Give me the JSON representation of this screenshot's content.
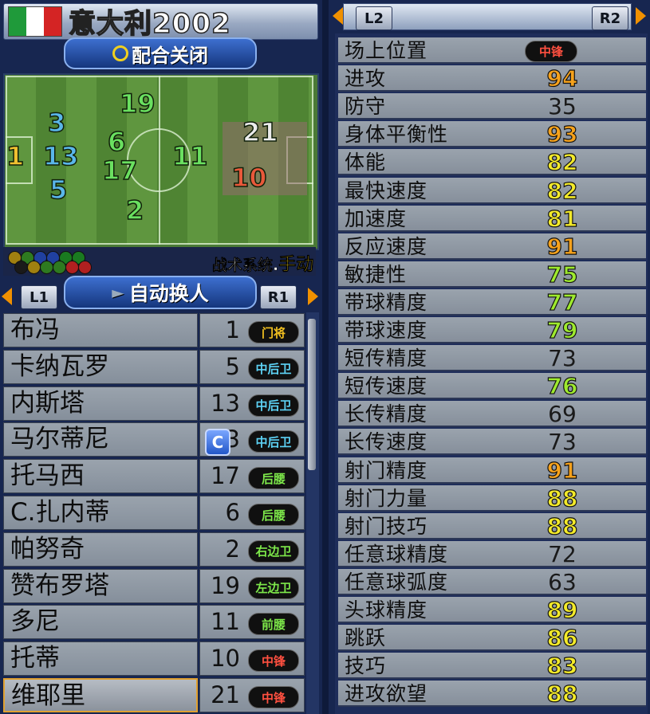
{
  "team": {
    "name": "意大利2002",
    "flag_colors": [
      "#1f9a3a",
      "#ffffff",
      "#d42424"
    ]
  },
  "tactic_button": {
    "label": "配合关闭",
    "key_icon": "circle-button-icon"
  },
  "pitch": {
    "players": [
      {
        "number": "1",
        "role": "gk"
      },
      {
        "number": "3",
        "role": "df"
      },
      {
        "number": "13",
        "role": "df"
      },
      {
        "number": "5",
        "role": "df"
      },
      {
        "number": "19",
        "role": "mf"
      },
      {
        "number": "6",
        "role": "mf"
      },
      {
        "number": "17",
        "role": "mf"
      },
      {
        "number": "2",
        "role": "mf"
      },
      {
        "number": "11",
        "role": "mf"
      },
      {
        "number": "21",
        "role": "fw-white"
      },
      {
        "number": "10",
        "role": "fw-red"
      }
    ],
    "system_label": "战术系统.",
    "system_mode": "手动",
    "dot_colors": [
      "#a08010",
      "#2e7a20",
      "#2040a0",
      "#2040a0",
      "#1a7a20",
      "#1a7a20",
      "#1a1a1a",
      "#a08010",
      "#2e7a20",
      "#2e7a20",
      "#b02020",
      "#b02020"
    ]
  },
  "nav": {
    "l1": "L1",
    "r1": "R1",
    "l2": "L2",
    "r2": "R2",
    "auto_sub_label": "自动换人"
  },
  "roster": [
    {
      "name": "布冯",
      "number": "1",
      "position": "门将",
      "pos_class": "gk"
    },
    {
      "name": "卡纳瓦罗",
      "number": "5",
      "position": "中后卫",
      "pos_class": "df"
    },
    {
      "name": "内斯塔",
      "number": "13",
      "position": "中后卫",
      "pos_class": "df"
    },
    {
      "name": "马尔蒂尼",
      "number": "3",
      "position": "中后卫",
      "pos_class": "df",
      "captain": "C"
    },
    {
      "name": "托马西",
      "number": "17",
      "position": "后腰",
      "pos_class": "mf"
    },
    {
      "name": "C.扎内蒂",
      "number": "6",
      "position": "后腰",
      "pos_class": "mf"
    },
    {
      "name": "帕努奇",
      "number": "2",
      "position": "右边卫",
      "pos_class": "mf"
    },
    {
      "name": "赞布罗塔",
      "number": "19",
      "position": "左边卫",
      "pos_class": "mf"
    },
    {
      "name": "多尼",
      "number": "11",
      "position": "前腰",
      "pos_class": "mf"
    },
    {
      "name": "托蒂",
      "number": "10",
      "position": "中锋",
      "pos_class": "fw"
    },
    {
      "name": "维耶里",
      "number": "21",
      "position": "中锋",
      "pos_class": "fw"
    }
  ],
  "stats": [
    {
      "label": "场上位置",
      "value": "中锋",
      "style": "badge"
    },
    {
      "label": "进攻",
      "value": "94",
      "style": "orange"
    },
    {
      "label": "防守",
      "value": "35",
      "style": "plain"
    },
    {
      "label": "身体平衡性",
      "value": "93",
      "style": "orange"
    },
    {
      "label": "体能",
      "value": "82",
      "style": "yellow"
    },
    {
      "label": "最快速度",
      "value": "82",
      "style": "yellow"
    },
    {
      "label": "加速度",
      "value": "81",
      "style": "yellow"
    },
    {
      "label": "反应速度",
      "value": "91",
      "style": "orange"
    },
    {
      "label": "敏捷性",
      "value": "75",
      "style": "lime"
    },
    {
      "label": "带球精度",
      "value": "77",
      "style": "lime"
    },
    {
      "label": "带球速度",
      "value": "79",
      "style": "lime"
    },
    {
      "label": "短传精度",
      "value": "73",
      "style": "plain"
    },
    {
      "label": "短传速度",
      "value": "76",
      "style": "lime"
    },
    {
      "label": "长传精度",
      "value": "69",
      "style": "plain"
    },
    {
      "label": "长传速度",
      "value": "73",
      "style": "plain"
    },
    {
      "label": "射门精度",
      "value": "91",
      "style": "orange"
    },
    {
      "label": "射门力量",
      "value": "88",
      "style": "yellow"
    },
    {
      "label": "射门技巧",
      "value": "88",
      "style": "yellow"
    },
    {
      "label": "任意球精度",
      "value": "72",
      "style": "plain"
    },
    {
      "label": "任意球弧度",
      "value": "63",
      "style": "plain"
    },
    {
      "label": "头球精度",
      "value": "89",
      "style": "yellow"
    },
    {
      "label": "跳跃",
      "value": "86",
      "style": "yellow"
    },
    {
      "label": "技巧",
      "value": "83",
      "style": "yellow"
    },
    {
      "label": "进攻欲望",
      "value": "88",
      "style": "yellow"
    }
  ]
}
